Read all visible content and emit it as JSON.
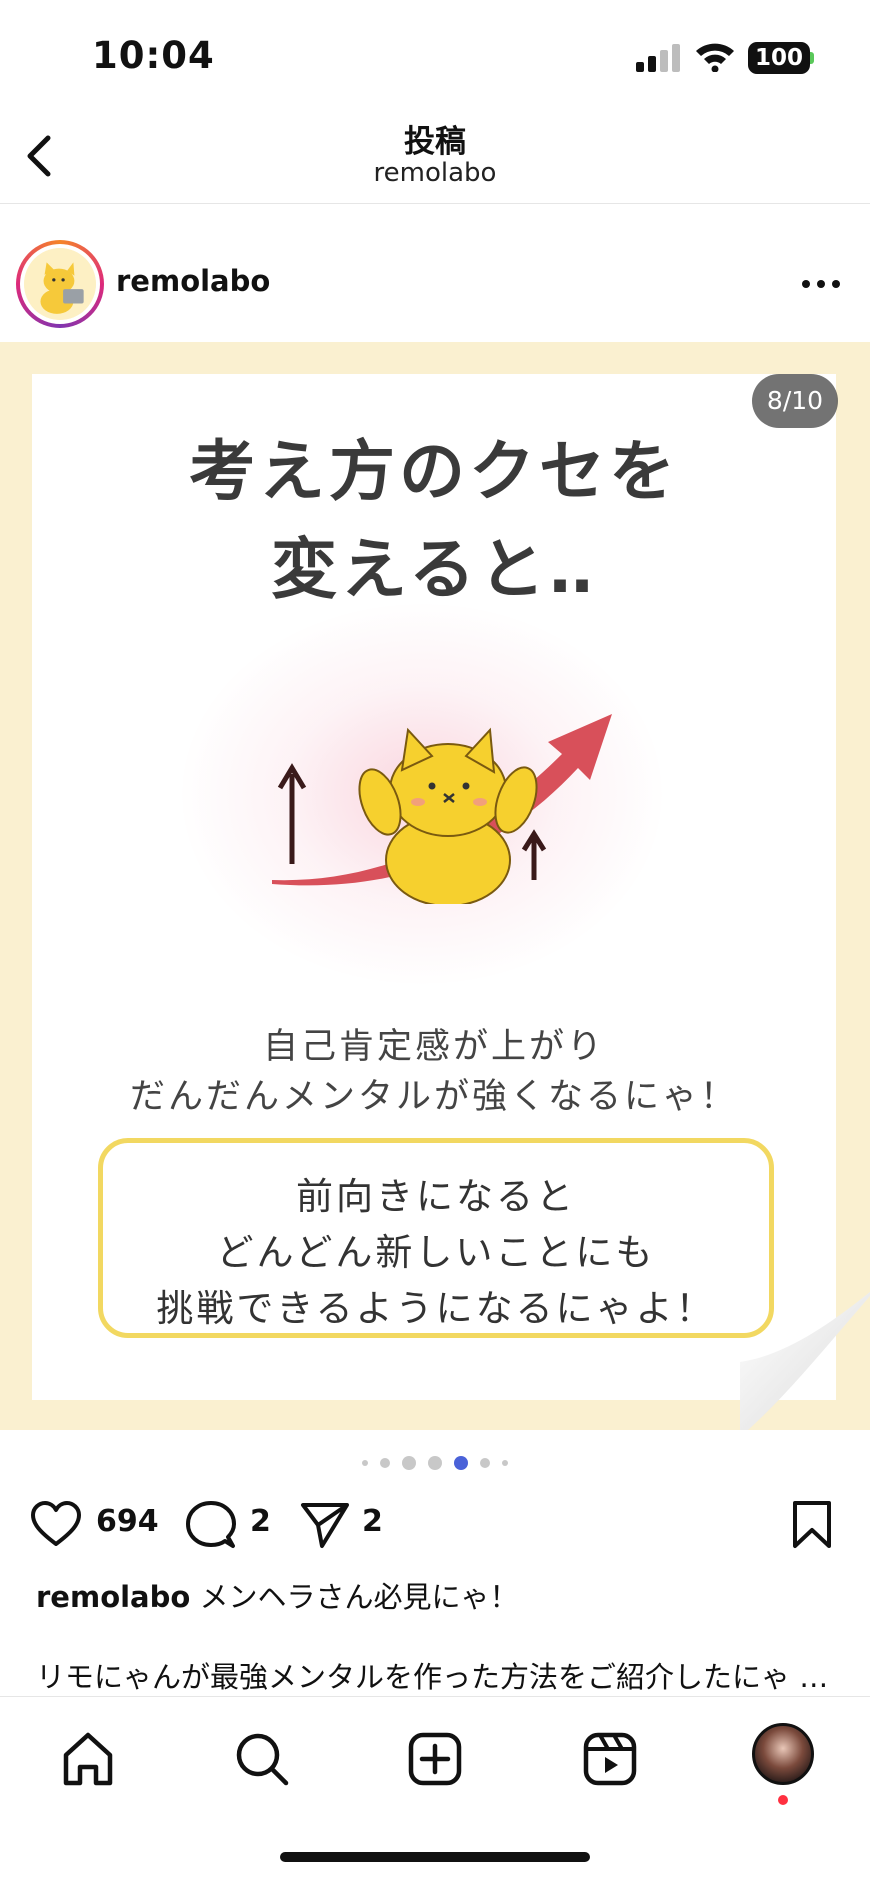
{
  "status_bar": {
    "time": "10:04",
    "battery": "100"
  },
  "header": {
    "title": "投稿",
    "subtitle": "remolabo"
  },
  "post": {
    "username": "remolabo",
    "page_indicator": "8/10",
    "image_text": {
      "headline_line1": "考え方のクセを",
      "headline_line2": "変えると‥",
      "body_line1": "自己肯定感が上がり",
      "body_line2": "だんだんメンタルが強くなるにゃ！",
      "callout_line1": "前向きになると",
      "callout_line2": "どんどん新しいことにも",
      "callout_line3": "挑戦できるようになるにゃよ！"
    },
    "carousel": {
      "total_visible_dots": 7,
      "active_index": 4
    },
    "likes": "694",
    "comments": "2",
    "shares": "2",
    "caption_user": "remolabo",
    "caption_text": "メンヘラさん必見にゃ！",
    "caption_line2": "リモにゃんが最強メンタルを作った方法をご紹介したにゃ …"
  },
  "icons": {
    "back": "chevron-left-icon",
    "more": "more-horizontal-icon",
    "like": "heart-icon",
    "comment": "comment-icon",
    "share": "send-icon",
    "save": "bookmark-icon",
    "home": "home-icon",
    "search": "search-icon",
    "create": "plus-square-icon",
    "reels": "reels-icon"
  },
  "colors": {
    "accent_dot": "#4a62d8",
    "image_bg": "#faf0d0",
    "callout_border": "#f2d861",
    "notification": "#ff3040"
  }
}
